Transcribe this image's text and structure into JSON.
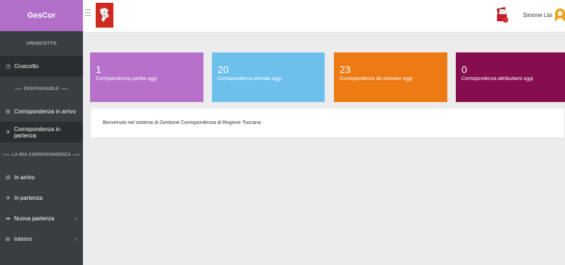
{
  "brand": "GesCor",
  "sidebar": {
    "section_dashboard": "CRUSCOTTO",
    "dashboard_item": "Cruscotto",
    "section_responsabile": "RESPONSABILE",
    "resp_items": [
      "Corrispondenza in arrivo",
      "Corrispondenza in partenza"
    ],
    "section_mine": "LA MIA CORRISPONDENZA",
    "mine_items": [
      "In arrivo",
      "In partenza",
      "Nuova partenza",
      "Interno"
    ]
  },
  "topbar": {
    "user_name": "Simone Lisi"
  },
  "cards": [
    {
      "value": "1",
      "label": "Corrispondenza partita oggi",
      "color": "#b771cb"
    },
    {
      "value": "20",
      "label": "Corrispondenza arrivata oggi",
      "color": "#6dc0ec"
    },
    {
      "value": "23",
      "label": "Corrispondenza da smistare oggi",
      "color": "#ee7a14"
    },
    {
      "value": "0",
      "label": "Corrispondenza attribuitami oggi",
      "color": "#860e4f"
    }
  ],
  "welcome": "Benvenuto nel sistema di Gestione Corrispondenza di Regione Toscana",
  "colors": {
    "sidebar": "#393e42",
    "brand": "#b26fc9",
    "active": "#2a2e31"
  }
}
